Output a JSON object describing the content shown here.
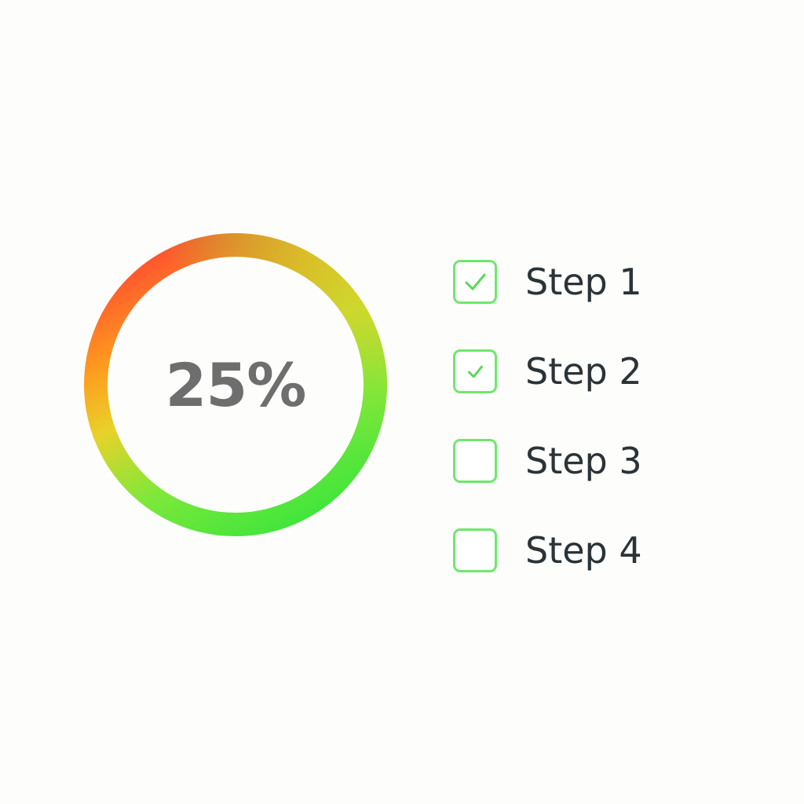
{
  "progress": {
    "label": "25%",
    "value": 25,
    "gradient_colors": [
      "#ff5a2e",
      "#ffb21d",
      "#e4d42a",
      "#8ee83a",
      "#43e83a"
    ]
  },
  "steps": [
    {
      "label": "Step 1",
      "checked": true
    },
    {
      "label": "Step 2",
      "checked": true
    },
    {
      "label": "Step 3",
      "checked": false
    },
    {
      "label": "Step 4",
      "checked": false
    }
  ],
  "colors": {
    "checkbox_border": "#6ee86a",
    "checkmark": "#5ad857",
    "percent_text": "#6e6e6e",
    "step_text": "#2b3336",
    "background": "#fdfdfc"
  },
  "icons": {
    "checked": "checkmark-icon"
  }
}
